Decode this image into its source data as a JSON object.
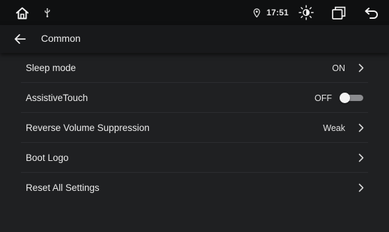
{
  "status_bar": {
    "home_icon": "home-icon",
    "usb_icon": "usb-icon",
    "location_icon": "location-pin-icon",
    "time": "17:51",
    "brightness_icon": "brightness-icon",
    "recents_icon": "recent-apps-icon",
    "back_icon": "back-arrow-icon"
  },
  "header": {
    "back_icon": "arrow-left-icon",
    "title": "Common"
  },
  "settings": [
    {
      "label": "Sleep mode",
      "value": "ON",
      "control": "chevron"
    },
    {
      "label": "AssistiveTouch",
      "value": "OFF",
      "control": "toggle",
      "toggle_on": false
    },
    {
      "label": "Reverse Volume Suppression",
      "value": "Weak",
      "control": "chevron"
    },
    {
      "label": "Boot Logo",
      "value": "",
      "control": "chevron"
    },
    {
      "label": "Reset All Settings",
      "value": "",
      "control": "chevron"
    }
  ],
  "colors": {
    "background": "#1f2022",
    "status_bar": "#0f1011",
    "title_bar": "#18191b",
    "text": "#ebebeb",
    "toggle_track_off": "#8a8b8e"
  }
}
